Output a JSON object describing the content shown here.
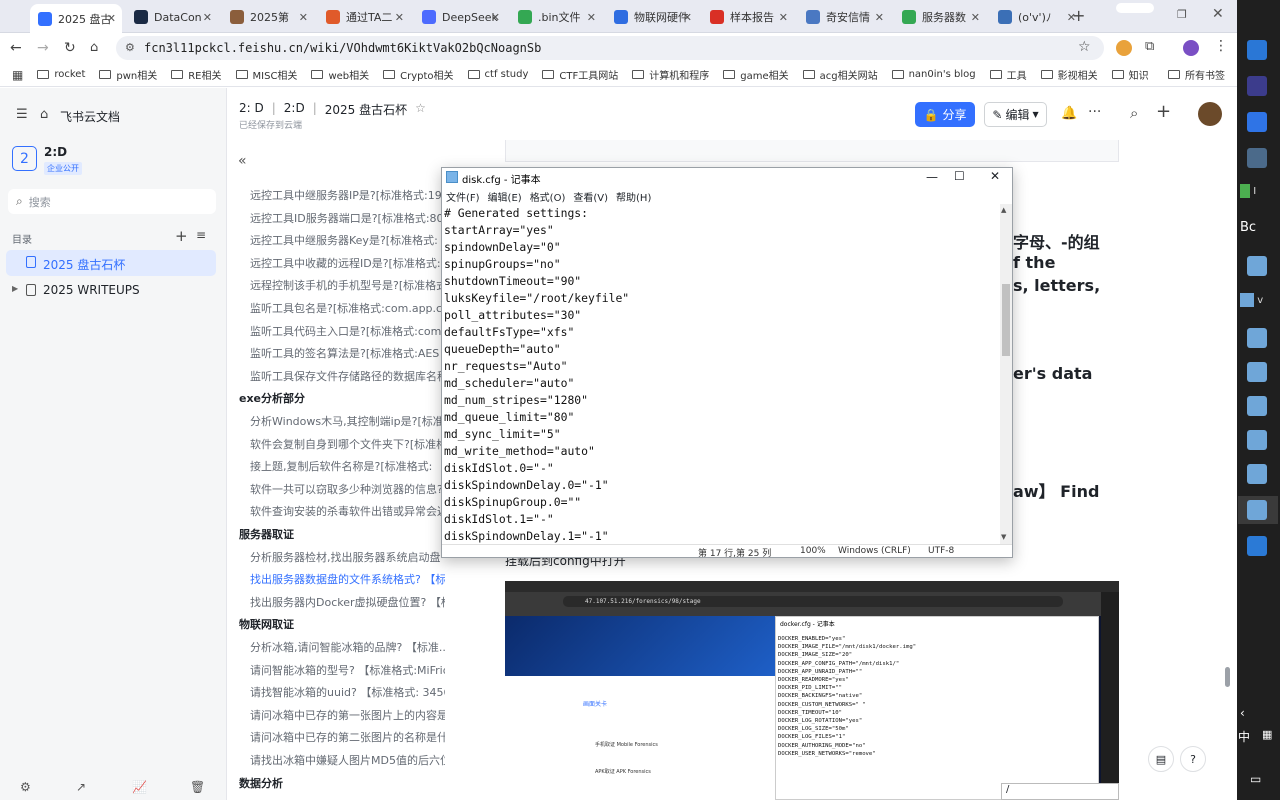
{
  "browser": {
    "tabs": [
      {
        "label": "2025 盘古",
        "color": "#3370ff",
        "icon": "doc-icon"
      },
      {
        "label": "DataCon",
        "color": "#1a2a44",
        "icon": "datacon-icon"
      },
      {
        "label": "2025第",
        "color": "#8b5e3c",
        "icon": "avatar-icon"
      },
      {
        "label": "通过TA二",
        "color": "#e05a2a",
        "icon": "c-icon"
      },
      {
        "label": "DeepSeek",
        "color": "#4d6bfe",
        "icon": "deepseek-icon"
      },
      {
        "label": ".bin文件",
        "color": "#34a853",
        "icon": "google-icon"
      },
      {
        "label": "物联网硬件",
        "color": "#2f6de1",
        "icon": "zhihu-icon"
      },
      {
        "label": "样本报告",
        "color": "#d93025",
        "icon": "s-icon"
      },
      {
        "label": "奇安信情",
        "color": "#4a78c2",
        "icon": "qax-icon"
      },
      {
        "label": "服务器数",
        "color": "#34a853",
        "icon": "google-icon"
      },
      {
        "label": "(o'v')ﾉ",
        "color": "#3b6fb6",
        "icon": "blog-icon"
      }
    ],
    "url": "fcn3l11pckcl.feishu.cn/wiki/VOhdwmt6KiktVakO2bQcNoagnSb",
    "bookmarks": [
      "rocket",
      "pwn相关",
      "RE相关",
      "MISC相关",
      "web相关",
      "Crypto相关",
      "ctf study",
      "CTF工具网站",
      "计算机和程序",
      "game相关",
      "acg相关网站",
      "nan0in's blog",
      "工具",
      "影视相关",
      "知识"
    ],
    "all_bookmarks": "所有书签"
  },
  "feishu": {
    "brand": "飞书云文档",
    "space_name": "2:D",
    "space_icon": "2",
    "space_tag": "企业公开",
    "search_placeholder": "搜索",
    "dir_label": "目录",
    "tree": [
      {
        "label": "2025 盘古石杯",
        "active": true
      },
      {
        "label": "2025 WRITEUPS",
        "active": false
      }
    ],
    "breadcrumb": [
      "2: D",
      "2:D",
      "2025 盘古石杯"
    ],
    "save_status": "已经保存到云端",
    "share_label": "分享",
    "edit_label": "编辑",
    "toc": [
      {
        "text": "远控工具中继服务器IP是?[标准格式:19",
        "type": "item"
      },
      {
        "text": "远控工具ID服务器端口是?[标准格式:80",
        "type": "item"
      },
      {
        "text": "远控工具中继服务器Key是?[标准格式:",
        "type": "item"
      },
      {
        "text": "远控工具中收藏的远程ID是?[标准格式:",
        "type": "item"
      },
      {
        "text": "远程控制该手机的手机型号是?[标准格式",
        "type": "item"
      },
      {
        "text": "监听工具包名是?[标准格式:com.app.cp",
        "type": "item"
      },
      {
        "text": "监听工具代码主入口是?[标准格式:com",
        "type": "item"
      },
      {
        "text": "监听工具的签名算法是?[标准格式:AES",
        "type": "item"
      },
      {
        "text": "监听工具保存文件存储路径的数据库名称",
        "type": "item"
      },
      {
        "text": "exe分析部分",
        "type": "sec"
      },
      {
        "text": "分析Windows木马,其控制端ip是?[标准",
        "type": "item"
      },
      {
        "text": "软件会复制自身到哪个文件夹下?[标准格",
        "type": "item"
      },
      {
        "text": "接上题,复制后软件名称是?[标准格式:",
        "type": "item"
      },
      {
        "text": "软件一共可以窃取多少种浏览器的信息?[",
        "type": "item"
      },
      {
        "text": "软件查询安装的杀毒软件出错或异常会返",
        "type": "item"
      },
      {
        "text": "服务器取证",
        "type": "sec"
      },
      {
        "text": "分析服务器检材,找出服务器系统启动盘",
        "type": "item"
      },
      {
        "text": "找出服务器数据盘的文件系统格式? 【标...",
        "type": "cur"
      },
      {
        "text": "找出服务器内Docker虚拟硬盘位置? 【标...",
        "type": "item"
      },
      {
        "text": "物联网取证",
        "type": "sec"
      },
      {
        "text": "分析冰箱,请问智能冰箱的品牌? 【标准...",
        "type": "item"
      },
      {
        "text": "请问智能冰箱的型号? 【标准格式:MiFridg...",
        "type": "item"
      },
      {
        "text": "请找智能冰箱的uuid? 【标准格式: 34567...",
        "type": "item"
      },
      {
        "text": "请问冰箱中已存的第一张图片上的内容是...",
        "type": "item"
      },
      {
        "text": "请问冰箱中已存的第二张图片的名称是什...",
        "type": "item"
      },
      {
        "text": "请找出冰箱中嫌疑人图片MD5值的后六位...",
        "type": "item"
      },
      {
        "text": "数据分析",
        "type": "sec"
      }
    ],
    "body_fragments": [
      "字母、-的组",
      "f the",
      "s, letters,",
      "er's data",
      "aw】 Find",
      "挂载后到config中打开"
    ]
  },
  "notepad": {
    "title": "disk.cfg - 记事本",
    "menu": [
      "文件(F)",
      "编辑(E)",
      "格式(O)",
      "查看(V)",
      "帮助(H)"
    ],
    "lines": [
      "# Generated settings:",
      "startArray=\"yes\"",
      "spindownDelay=\"0\"",
      "spinupGroups=\"no\"",
      "shutdownTimeout=\"90\"",
      "luksKeyfile=\"/root/keyfile\"",
      "poll_attributes=\"30\"",
      "defaultFsType=\"xfs\"",
      "queueDepth=\"auto\"",
      "nr_requests=\"Auto\"",
      "md_scheduler=\"auto\"",
      "md_num_stripes=\"1280\"",
      "md_queue_limit=\"80\"",
      "md_sync_limit=\"5\"",
      "md_write_method=\"auto\"",
      "diskIdSlot.0=\"-\"",
      "diskSpindownDelay.0=\"-1\"",
      "diskSpinupGroup.0=\"\"",
      "diskIdSlot.1=\"-\"",
      "diskSpindownDelay.1=\"-1\""
    ],
    "status_pos": "第 17 行,第 25 列",
    "status_zoom": "100%",
    "status_eol": "Windows (CRLF)",
    "status_enc": "UTF-8"
  },
  "embed": {
    "url": "47.107.51.216/forensics/98/stage",
    "notepad_title": "docker.cfg - 记事本",
    "lines": [
      "DOCKER_ENABLED=\"yes\"",
      "DOCKER_IMAGE_FILE=\"/mnt/disk1/docker.img\"",
      "DOCKER_IMAGE_SIZE=\"20\"",
      "DOCKER_APP_CONFIG_PATH=\"/mnt/disk1/\"",
      "DOCKER_APP_UNRAID_PATH=\"\"",
      "DOCKER_READMORE=\"yes\"",
      "DOCKER_PID_LIMIT=\"\"",
      "DOCKER_BACKINGFS=\"native\"",
      "DOCKER_CUSTOM_NETWORKS=\" \"",
      "DOCKER_TIMEOUT=\"10\"",
      "DOCKER_LOG_ROTATION=\"yes\"",
      "DOCKER_LOG_SIZE=\"50m\"",
      "DOCKER_LOG_FILES=\"1\"",
      "DOCKER_AUTHORING_MODE=\"no\"",
      "DOCKER_USER_NETWORKS=\"remove\""
    ],
    "panel_title": "画面关卡",
    "panel_items": [
      "手机取证 Mobile Forensics",
      "APK取证 APK Forensics"
    ]
  },
  "dock": {
    "labels": [
      "I",
      "v",
      "s",
      "Bc"
    ]
  }
}
